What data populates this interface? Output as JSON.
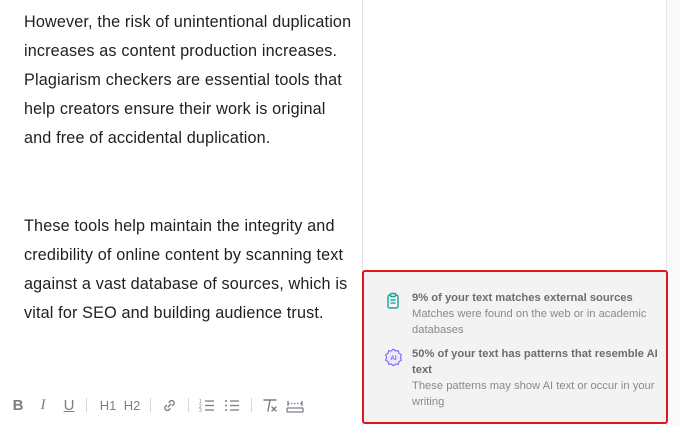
{
  "editor": {
    "paragraphs": [
      "However, the risk of unintentional duplication increases as content production increases. Plagiarism checkers are essential tools that help creators ensure their work is original and free of accidental duplication.",
      "These tools help maintain the integrity and credibility of online content by scanning text against a vast database of sources, which is vital for SEO and building audience trust."
    ]
  },
  "toolbar": {
    "bold": "B",
    "italic": "I",
    "underline": "U",
    "h1": "H1",
    "h2": "H2",
    "icons": [
      "link-icon",
      "ordered-list-icon",
      "bullet-list-icon",
      "clear-format-icon",
      "ruler-icon"
    ]
  },
  "results": {
    "items": [
      {
        "title": "9% of your text matches external sources",
        "desc": "Matches were found on the web or in academic databases",
        "icon": "clipboard-icon",
        "color": "#18a59a"
      },
      {
        "title": "50% of your text has patterns that resemble AI text",
        "desc": "These patterns may show AI text or occur in your writing",
        "icon": "ai-badge-icon",
        "color": "#7a5cf0"
      }
    ],
    "highlight_color": "#e3141b"
  }
}
